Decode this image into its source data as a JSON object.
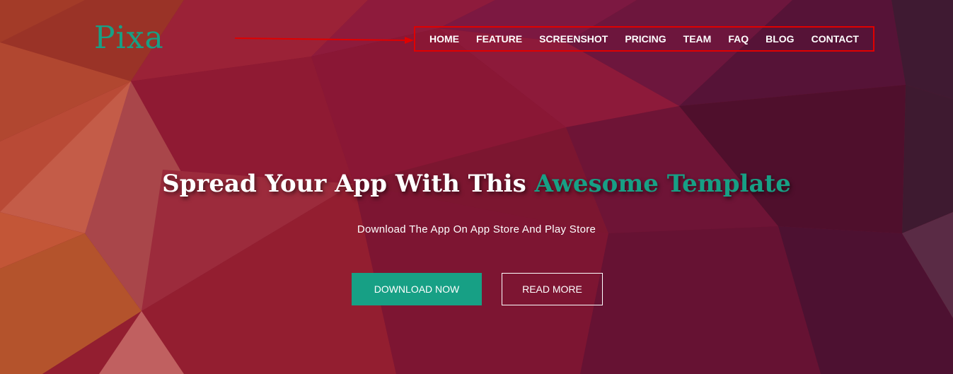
{
  "header": {
    "logo": "Pixa",
    "nav": [
      "HOME",
      "FEATURE",
      "SCREENSHOT",
      "PRICING",
      "TEAM",
      "FAQ",
      "BLOG",
      "CONTACT"
    ]
  },
  "hero": {
    "title_main": "Spread Your App With This",
    "title_accent": "Awesome Template",
    "subtitle": "Download The App On App Store And Play Store",
    "primary_button": "DOWNLOAD NOW",
    "secondary_button": "READ MORE"
  },
  "colors": {
    "accent": "#17a085",
    "annotation": "#e00000",
    "bg_dark": "#6b1533"
  }
}
